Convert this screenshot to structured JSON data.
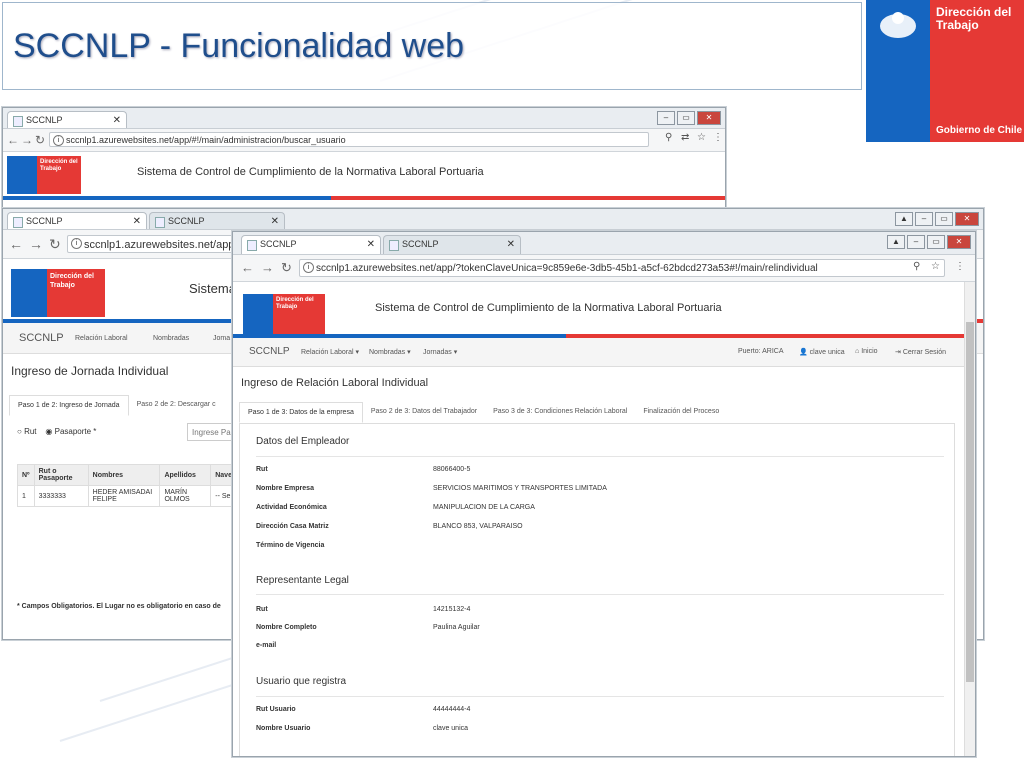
{
  "slide": {
    "title": "SCCNLP - Funcionalidad web",
    "brand": {
      "name_line1": "Dirección del",
      "name_line2": "Trabajo",
      "gobierno": "Gobierno de Chile"
    }
  },
  "win1": {
    "tab": "SCCNLP",
    "url": "sccnlp1.azurewebsites.net/app/#!/main/administracion/buscar_usuario",
    "app_title": "Sistema de Control de Cumplimiento de la Normativa Laboral Portuaria",
    "logo_text": "Dirección del Trabajo"
  },
  "win2": {
    "tab1": "SCCNLP",
    "tab2": "SCCNLP",
    "url": "sccnlp1.azurewebsites.net/app/#!/",
    "app_title": "Sistema",
    "logo_text": "Dirección del Trabajo",
    "nav": {
      "brand": "SCCNLP",
      "item1": "Relación Laboral",
      "item2": "Nombradas",
      "item3": "Joma"
    },
    "heading": "Ingreso de Jornada Individual",
    "tabs": [
      "Paso 1 de 2: Ingreso de Jornada",
      "Paso 2 de 2: Descargar c"
    ],
    "radio_rut": "Rut",
    "radio_pasaporte": "Pasaporte *",
    "input_placeholder": "Ingrese Pas",
    "table": {
      "headers": [
        "Nº",
        "Rut o Pasaporte",
        "Nombres",
        "Apellidos",
        "Nave"
      ],
      "rows": [
        [
          "1",
          "3333333",
          "HEDER AMISADAI FELIPE",
          "MARÍN OLMOS",
          "-- Se"
        ]
      ]
    },
    "footnote": "* Campos Obligatorios. El Lugar no es obligatorio en caso de"
  },
  "win3": {
    "tab1": "SCCNLP",
    "tab2": "SCCNLP",
    "url": "sccnlp1.azurewebsites.net/app/?tokenClaveUnica=9c859e6e-3db5-45b1-a5cf-62bdcd273a53#!/main/relindividual",
    "app_title": "Sistema de Control de Cumplimiento de la Normativa Laboral Portuaria",
    "logo_text": "Dirección del Trabajo",
    "nav": {
      "brand": "SCCNLP",
      "item1": "Relación Laboral",
      "item2": "Nombradas",
      "item3": "Jornadas",
      "puerto": "Puerto: ARICA",
      "user": "clave unica",
      "inicio": "Inicio",
      "cerrar": "Cerrar Sesión"
    },
    "heading": "Ingreso de Relación Laboral Individual",
    "tabs": [
      "Paso 1 de 3: Datos de la empresa",
      "Paso 2 de 3: Datos del Trabajador",
      "Paso 3 de 3: Condiciones Relación Laboral",
      "Finalización del Proceso"
    ],
    "section_empleador": "Datos del Empleador",
    "empleador": [
      {
        "k": "Rut",
        "v": "88066400-5"
      },
      {
        "k": "Nombre Empresa",
        "v": "SERVICIOS MARITIMOS Y TRANSPORTES LIMITADA"
      },
      {
        "k": "Actividad Económica",
        "v": "MANIPULACION DE LA CARGA"
      },
      {
        "k": "Dirección Casa Matriz",
        "v": "BLANCO 853, VALPARAISO"
      },
      {
        "k": "Término de Vigencia",
        "v": ""
      }
    ],
    "section_representante": "Representante Legal",
    "representante": [
      {
        "k": "Rut",
        "v": "14215132-4"
      },
      {
        "k": "Nombre Completo",
        "v": "Paulina Aguilar"
      },
      {
        "k": "e-mail",
        "v": ""
      }
    ],
    "section_usuario": "Usuario que registra",
    "usuario": [
      {
        "k": "Rut Usuario",
        "v": "44444444-4"
      },
      {
        "k": "Nombre Usuario",
        "v": "clave unica"
      }
    ]
  }
}
